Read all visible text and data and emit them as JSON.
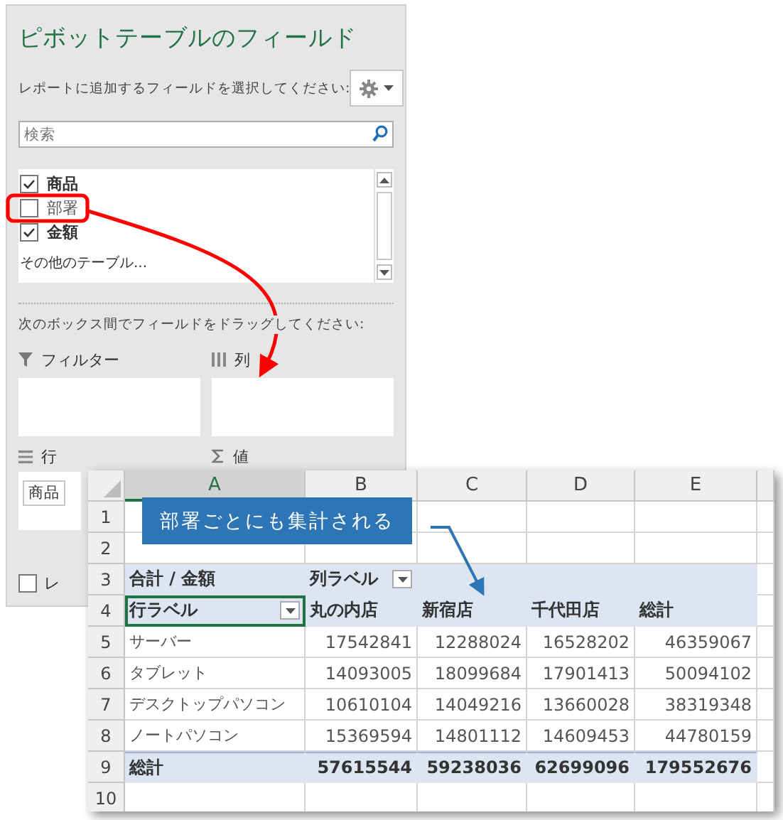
{
  "pivot_pane": {
    "title": "ピボットテーブルのフィールド",
    "subtitle": "レポートに追加するフィールドを選択してください:",
    "search": {
      "placeholder": "検索"
    },
    "fields": [
      {
        "label": "商品",
        "checked": true
      },
      {
        "label": "部署",
        "checked": false,
        "highlighted": true
      },
      {
        "label": "金額",
        "checked": true
      }
    ],
    "more_tables": "その他のテーブル...",
    "drag_hint": "次のボックス間でフィールドをドラッグしてください:",
    "areas": [
      {
        "kind": "filter",
        "label": "フィルター"
      },
      {
        "kind": "columns",
        "label": "列"
      },
      {
        "kind": "rows",
        "label": "行",
        "items": [
          "商品"
        ]
      },
      {
        "kind": "values",
        "label": "値"
      }
    ],
    "defer_update": {
      "label": "レ",
      "checked": false
    }
  },
  "callout": "部署ごとにも集計される",
  "sheet": {
    "columns": [
      "A",
      "B",
      "C",
      "D",
      "E"
    ],
    "rows": [
      {
        "number": "1",
        "kind": "blank"
      },
      {
        "number": "2",
        "kind": "blank"
      },
      {
        "number": "3",
        "kind": "header",
        "value_label": "合計 / 金額",
        "column_label": "列ラベル"
      },
      {
        "number": "4",
        "kind": "labels",
        "row_label": "行ラベル",
        "selected": true,
        "cells": [
          "丸の内店",
          "新宿店",
          "千代田店",
          "総計"
        ]
      },
      {
        "number": "5",
        "kind": "data",
        "label": "サーバー",
        "cells": [
          "17542841",
          "12288024",
          "16528202",
          "46359067"
        ]
      },
      {
        "number": "6",
        "kind": "data",
        "label": "タブレット",
        "cells": [
          "14093005",
          "18099684",
          "17901413",
          "50094102"
        ]
      },
      {
        "number": "7",
        "kind": "data",
        "label": "デスクトップパソコン",
        "cells": [
          "10610104",
          "14049216",
          "13660028",
          "38319348"
        ]
      },
      {
        "number": "8",
        "kind": "data",
        "label": "ノートパソコン",
        "cells": [
          "15369594",
          "14801112",
          "14609453",
          "44780159"
        ]
      },
      {
        "number": "9",
        "kind": "total",
        "label": "総計",
        "cells": [
          "57615544",
          "59238036",
          "62699096",
          "179552676"
        ]
      },
      {
        "number": "10",
        "kind": "blank"
      }
    ]
  }
}
